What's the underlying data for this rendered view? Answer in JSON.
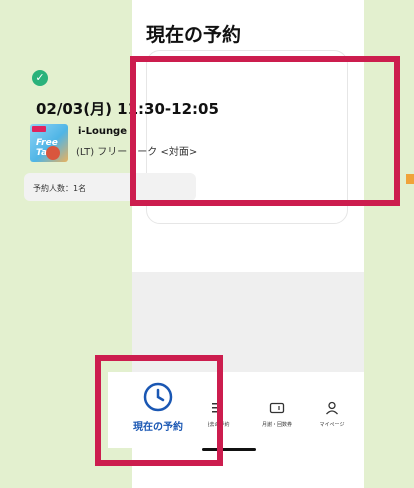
{
  "page": {
    "title": "現在の予約"
  },
  "reservation": {
    "datetime": "02/03(月) 11:30-12:05",
    "venue": "i-Lounge",
    "session": "(LT) フリートーク <対面>",
    "count": "予約人数：1名",
    "thumb_text": "Free Talk"
  },
  "tabs": [
    {
      "label": "現在の予約",
      "icon": "clock-icon"
    },
    {
      "label": "過去の予約",
      "icon": "list-icon"
    },
    {
      "label": "月謝・回数券",
      "icon": "ticket-icon"
    },
    {
      "label": "マイページ",
      "icon": "person-icon"
    }
  ],
  "colors": {
    "background": "#e3f0cf",
    "highlight": "#cc1d4e",
    "accent": "#1a57b3",
    "check": "#2ab27b"
  }
}
